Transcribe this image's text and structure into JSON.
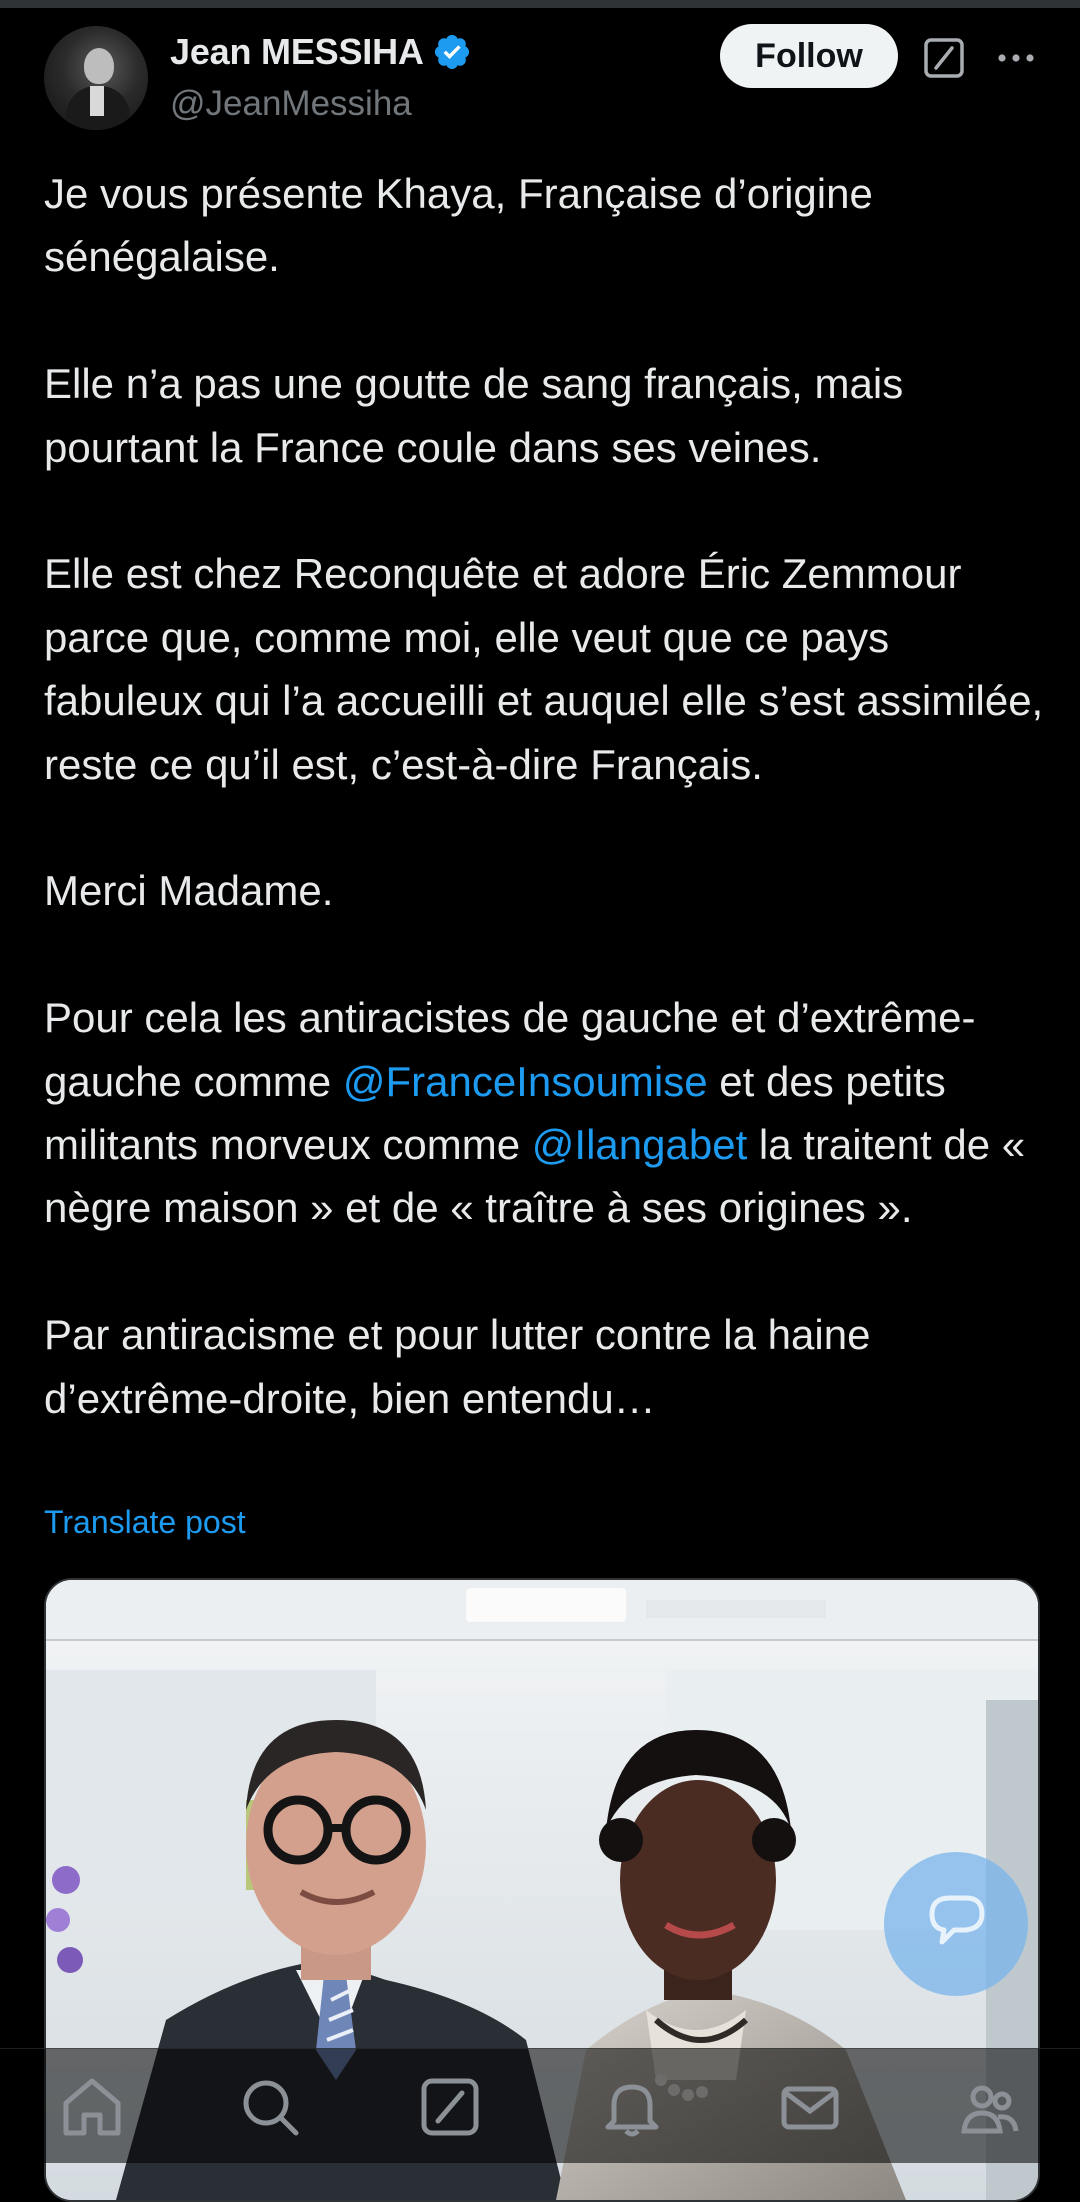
{
  "author": {
    "display_name": "Jean MESSIHA",
    "handle": "@JeanMessiha",
    "verified": true,
    "verified_icon": "verified-badge-icon"
  },
  "header": {
    "follow_label": "Follow",
    "grok_icon": "grok-icon",
    "more_icon": "more-options-icon"
  },
  "post": {
    "p1": "Je vous présente Khaya, Française d’origine sénégalaise.",
    "p2": "Elle n’a pas une goutte de sang français, mais pourtant la France coule dans ses veines.",
    "p3": "Elle est chez Reconquête et adore Éric Zemmour parce que, comme moi, elle veut que ce pays fabuleux qui l’a accueilli et auquel elle s’est assimilée, reste ce qu’il est, c’est-à-dire Français.",
    "p4": "Merci Madame.",
    "p5_a": "Pour cela les antiracistes de gauche et d’extrême-gauche comme ",
    "mention_1": "@FranceInsoumise",
    "p5_b": " et des petits militants morveux comme ",
    "mention_2": "@Ilangabet",
    "p5_c": " la traitent de « nègre maison » et de « traître à ses origines ».",
    "p6": "Par antiracisme et pour lutter contre la haine d’extrême-droite, bien entendu…",
    "translate_label": "Translate post"
  },
  "media": {
    "type": "photo"
  },
  "bottom_nav": {
    "icons": [
      "home-icon",
      "search-icon",
      "grok-icon",
      "notifications-icon",
      "messages-icon",
      "communities-icon"
    ]
  },
  "colors": {
    "background": "#000000",
    "text": "#e7e9ea",
    "secondary_text": "#71767b",
    "accent": "#1d9bf0",
    "follow_bg": "#eff3f4"
  }
}
